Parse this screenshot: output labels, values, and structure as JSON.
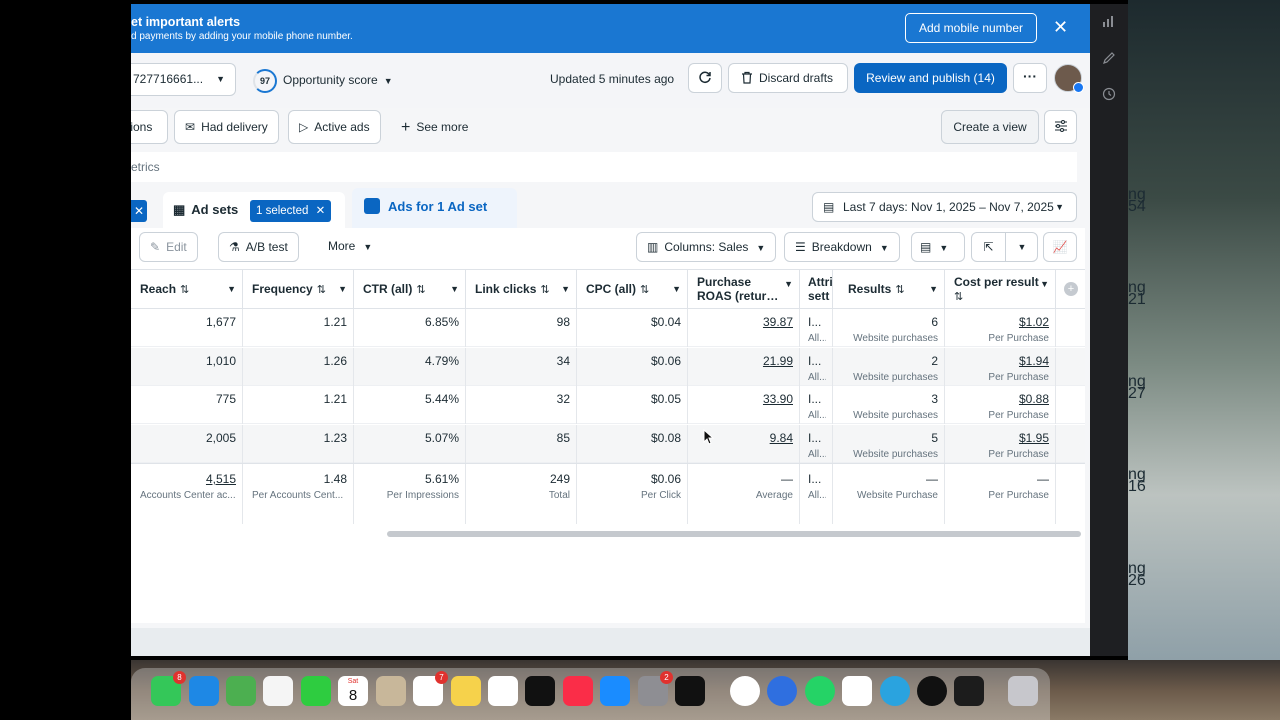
{
  "banner": {
    "title": "et important alerts",
    "subtitle": "d payments by adding your mobile phone number.",
    "add_mobile_label": "Add mobile number",
    "close_glyph": "✕"
  },
  "toolbar": {
    "account_id": "727716661...",
    "opportunity_score": "97",
    "opportunity_label": "Opportunity score",
    "updated_text": "Updated 5 minutes ago",
    "discard_label": "Discard drafts",
    "publish_label": "Review and publish (14)",
    "more_glyph": "···"
  },
  "filters": {
    "partial_chip": "tions",
    "had_delivery": "Had delivery",
    "active_ads": "Active ads",
    "see_more": "See more",
    "create_view": "Create a view"
  },
  "search": {
    "text": "etrics"
  },
  "tabs": {
    "adsets_label": "Ad sets",
    "selected_label": "1 selected",
    "ads_label": "Ads for 1 Ad set",
    "date_range": "Last 7 days: Nov 1, 2025 – Nov 7, 2025"
  },
  "actions": {
    "edit": "Edit",
    "ab_test": "A/B test",
    "more": "More",
    "columns": "Columns: Sales",
    "breakdown": "Breakdown"
  },
  "table": {
    "headers": {
      "reach": "Reach",
      "frequency": "Frequency",
      "ctr": "CTR (all)",
      "link_clicks": "Link clicks",
      "cpc": "CPC (all)",
      "roas_1": "Purchase",
      "roas_2": "ROAS (retur…",
      "attr_1": "Attri",
      "attr_2": "sett",
      "results": "Results",
      "cost_1": "Cost per result"
    },
    "rows": [
      {
        "reach": "1,677",
        "frequency": "1.21",
        "ctr": "6.85%",
        "link_clicks": "98",
        "cpc": "$0.04",
        "roas": "39.87",
        "attr": "I...",
        "attr_sub": "All...",
        "results": "6",
        "results_sub": "Website purchases",
        "cost": "$1.02",
        "cost_sub": "Per Purchase"
      },
      {
        "reach": "1,010",
        "frequency": "1.26",
        "ctr": "4.79%",
        "link_clicks": "34",
        "cpc": "$0.06",
        "roas": "21.99",
        "attr": "I...",
        "attr_sub": "All...",
        "results": "2",
        "results_sub": "Website purchases",
        "cost": "$1.94",
        "cost_sub": "Per Purchase"
      },
      {
        "reach": "775",
        "frequency": "1.21",
        "ctr": "5.44%",
        "link_clicks": "32",
        "cpc": "$0.05",
        "roas": "33.90",
        "attr": "I...",
        "attr_sub": "All...",
        "results": "3",
        "results_sub": "Website purchases",
        "cost": "$0.88",
        "cost_sub": "Per Purchase"
      },
      {
        "reach": "2,005",
        "frequency": "1.23",
        "ctr": "5.07%",
        "link_clicks": "85",
        "cpc": "$0.08",
        "roas": "9.84",
        "attr": "I...",
        "attr_sub": "All...",
        "results": "5",
        "results_sub": "Website purchases",
        "cost": "$1.95",
        "cost_sub": "Per Purchase"
      }
    ],
    "totals": {
      "reach": "4,515",
      "reach_sub": "Accounts Center ac...",
      "frequency": "1.48",
      "frequency_sub": "Per Accounts Cent...",
      "ctr": "5.61%",
      "ctr_sub": "Per Impressions",
      "link_clicks": "249",
      "link_clicks_sub": "Total",
      "cpc": "$0.06",
      "cpc_sub": "Per Click",
      "roas": "—",
      "roas_sub": "Average",
      "attr": "I...",
      "attr_sub": "All...",
      "results": "—",
      "results_sub": "Website Purchase",
      "cost": "—",
      "cost_sub": "Per Purchase"
    }
  },
  "desktop_labels": [
    "ng",
    "54",
    "ng",
    "21",
    "ng",
    "27",
    "ng",
    "16",
    "ng",
    "26"
  ],
  "dock_icons": [
    "messages",
    "mail",
    "maps",
    "photos",
    "facetime",
    "calendar",
    "contacts",
    "reminders",
    "notes",
    "freeform",
    "apple-tv",
    "music",
    "app-store",
    "system-settings",
    "capcut",
    "chrome",
    "proxyman",
    "whatsapp",
    "chatgpt",
    "telegram",
    "spotify",
    "istat",
    "trash"
  ],
  "dock_calendar": {
    "month": "Sat",
    "day": "8"
  },
  "dock_badges": {
    "messages": "8",
    "reminders": "7",
    "settings": "2"
  },
  "colors": {
    "primary": "#0a66c2",
    "banner": "#1a77d2"
  }
}
